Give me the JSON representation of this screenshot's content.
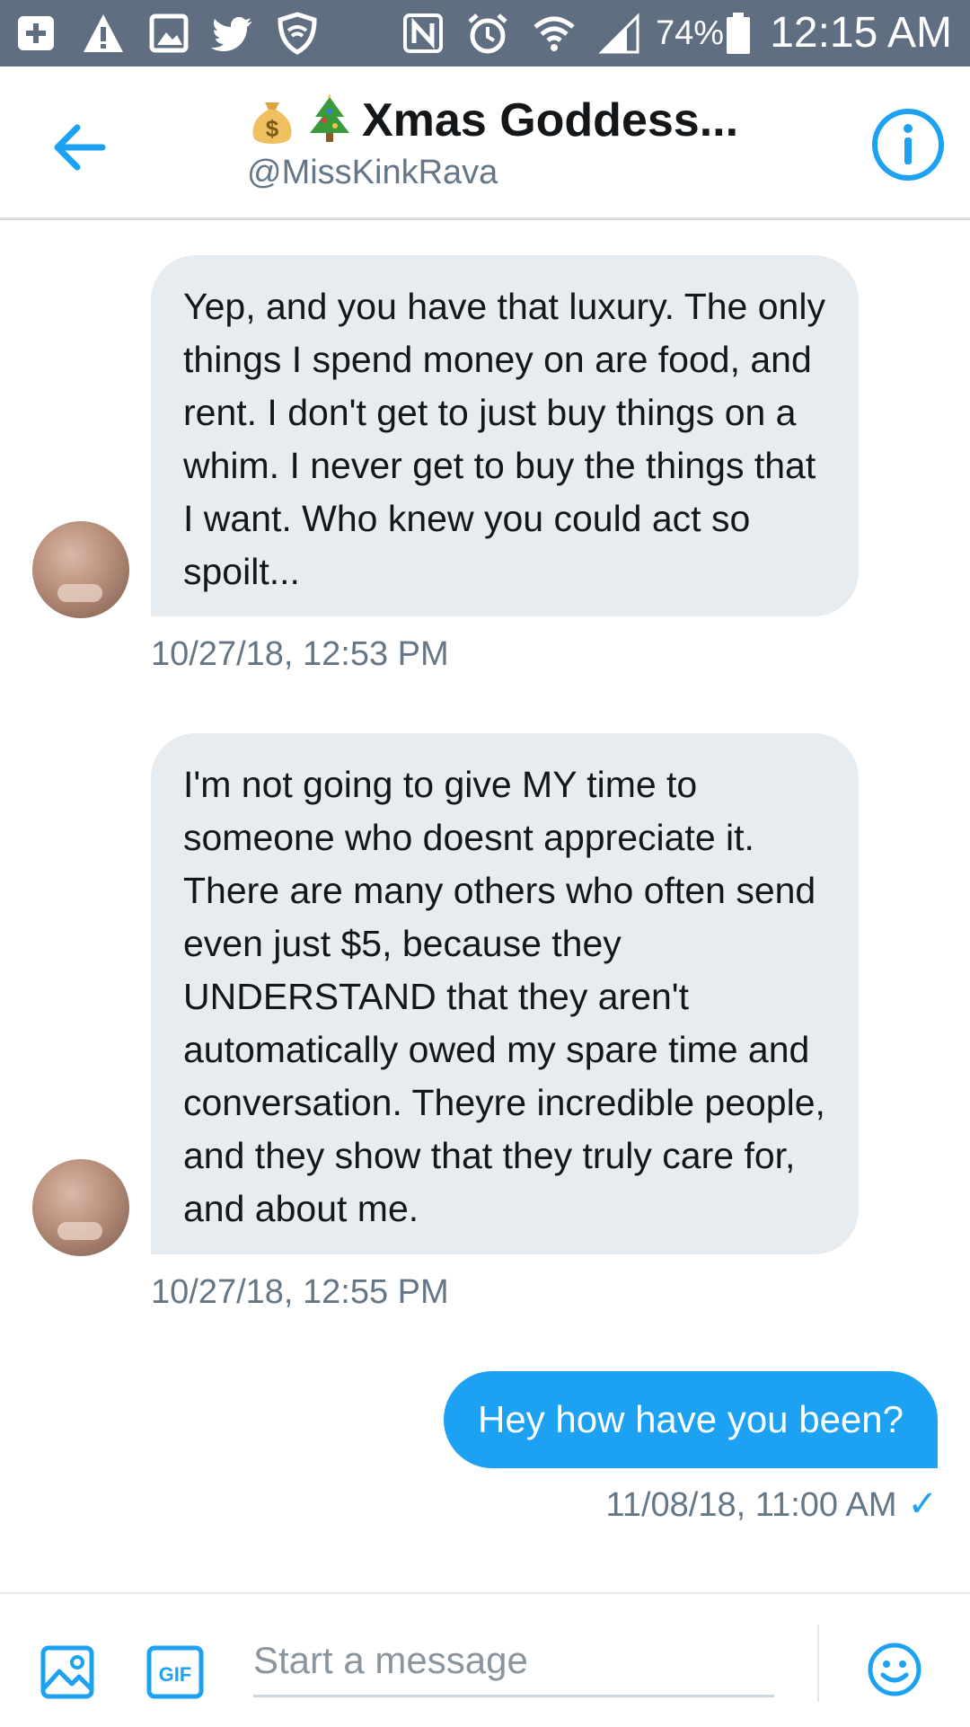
{
  "status_bar": {
    "battery_percent": "74%",
    "clock": "12:15 AM",
    "icons": [
      "add-icon",
      "warning-icon",
      "image-icon",
      "twitter-icon",
      "shield-icon",
      "nfc-icon",
      "alarm-icon",
      "wifi-icon",
      "signal-icon",
      "battery-icon"
    ]
  },
  "header": {
    "title": "Xmas Goddess...",
    "handle": "@MissKinkRava",
    "title_emojis": [
      "money-bag-icon",
      "christmas-tree-icon"
    ]
  },
  "messages": [
    {
      "direction": "incoming",
      "text": "Yep, and you have that luxury. The only things I spend money on are food, and rent. I don't get to just buy things on a whim. I never get to buy the things that I want. Who knew you could act so spoilt...",
      "timestamp": "10/27/18, 12:53 PM"
    },
    {
      "direction": "incoming",
      "text": "I'm not going to give MY time to someone who doesnt appreciate it. There are many others who often send even just $5, because they UNDERSTAND that they aren't automatically owed my spare time and conversation. Theyre incredible people, and they show that they truly care for, and about me.",
      "timestamp": "10/27/18, 12:55 PM"
    },
    {
      "direction": "outgoing",
      "text": "Hey how have you been?",
      "timestamp": "11/08/18, 11:00 AM",
      "read_check": "✓"
    }
  ],
  "composer": {
    "placeholder": "Start a message",
    "value": "",
    "gif_label": "GIF"
  },
  "colors": {
    "accent": "#1da1f2",
    "status_bar": "#5f6e80",
    "incoming_bubble": "#e6ecf0",
    "secondary_text": "#657786"
  }
}
